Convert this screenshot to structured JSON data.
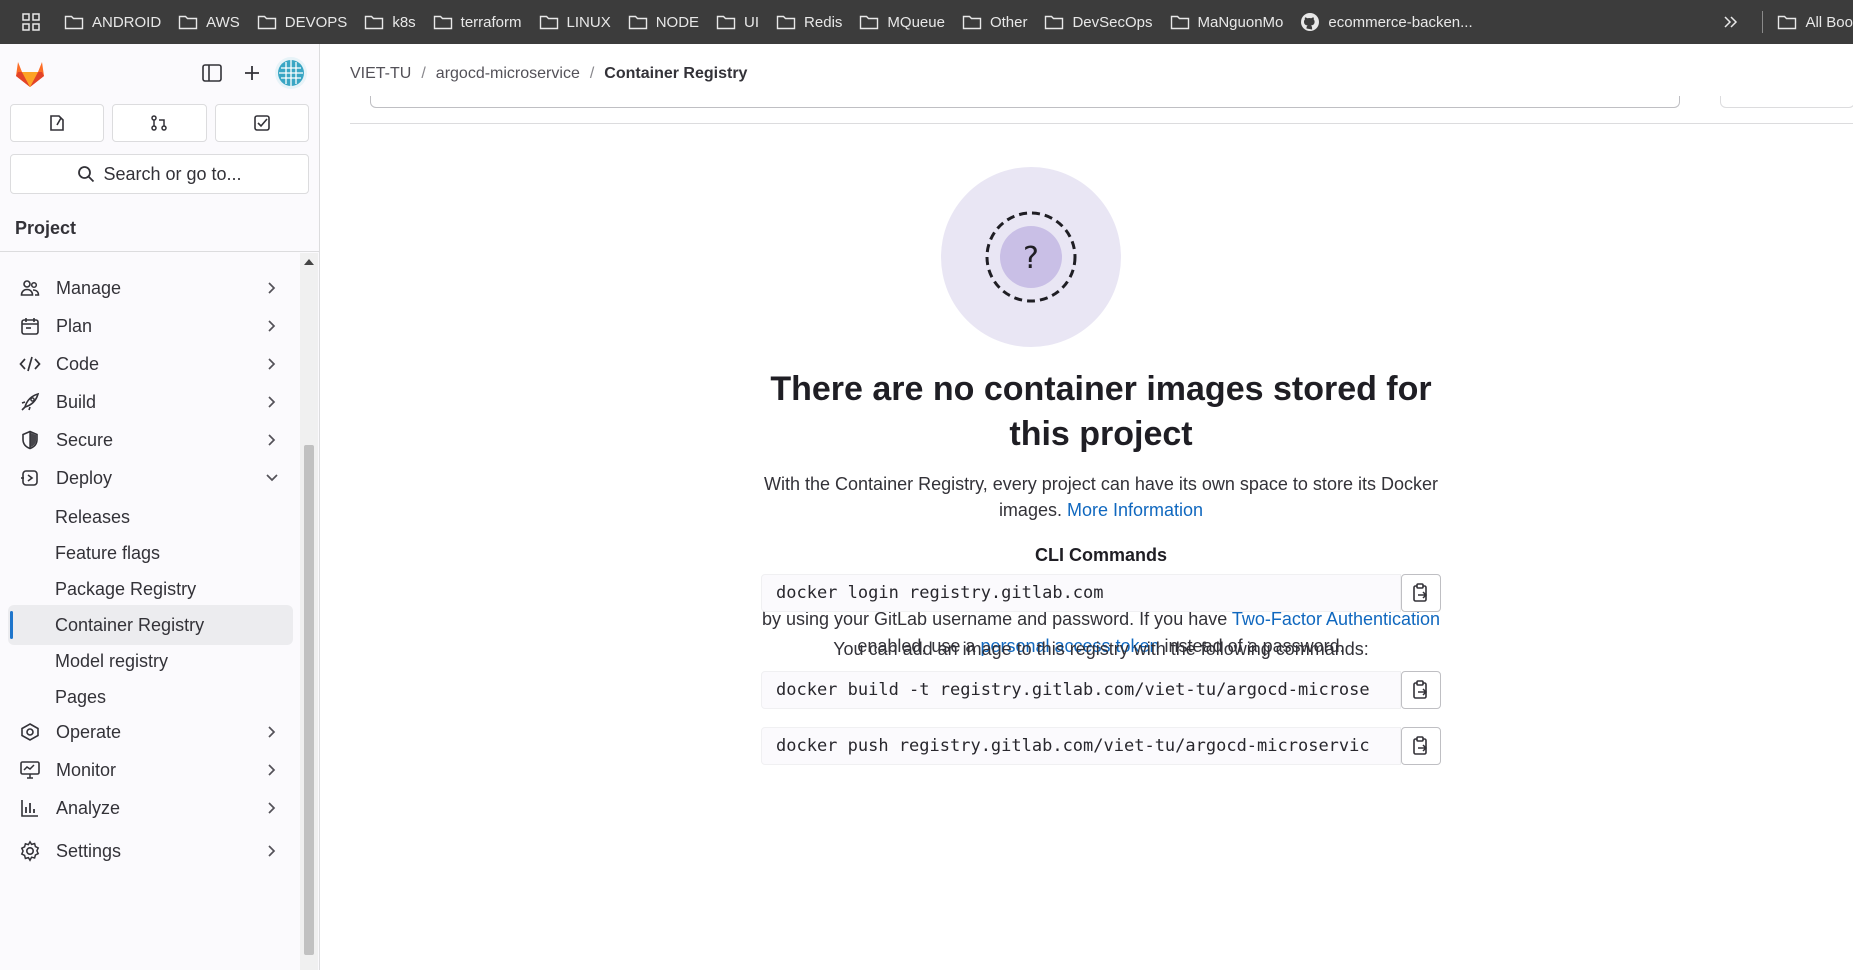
{
  "bookmarks": {
    "items": [
      {
        "label": "ANDROID",
        "icon": "folder-icon"
      },
      {
        "label": "AWS",
        "icon": "folder-icon"
      },
      {
        "label": "DEVOPS",
        "icon": "folder-icon"
      },
      {
        "label": "k8s",
        "icon": "folder-icon"
      },
      {
        "label": "terraform",
        "icon": "folder-icon"
      },
      {
        "label": "LINUX",
        "icon": "folder-icon"
      },
      {
        "label": "NODE",
        "icon": "folder-icon"
      },
      {
        "label": "UI",
        "icon": "folder-icon"
      },
      {
        "label": "Redis",
        "icon": "folder-icon"
      },
      {
        "label": "MQueue",
        "icon": "folder-icon"
      },
      {
        "label": "Other",
        "icon": "folder-icon"
      },
      {
        "label": "DevSecOps",
        "icon": "folder-icon"
      },
      {
        "label": "MaNguonMo",
        "icon": "folder-icon"
      },
      {
        "label": "ecommerce-backen...",
        "icon": "github-icon"
      }
    ],
    "all_bookmarks": "All Boo"
  },
  "sidebar": {
    "search_label": "Search or go to...",
    "section_title": "Project",
    "nav": [
      {
        "label": "Manage",
        "icon": "users-icon"
      },
      {
        "label": "Plan",
        "icon": "calendar-icon"
      },
      {
        "label": "Code",
        "icon": "code-icon"
      },
      {
        "label": "Build",
        "icon": "rocket-icon"
      },
      {
        "label": "Secure",
        "icon": "shield-icon"
      },
      {
        "label": "Deploy",
        "icon": "deploy-icon"
      }
    ],
    "deploy_sub": [
      "Releases",
      "Feature flags",
      "Package Registry",
      "Container Registry",
      "Model registry",
      "Pages"
    ],
    "nav_bottom": [
      {
        "label": "Operate",
        "icon": "operate-icon"
      },
      {
        "label": "Monitor",
        "icon": "monitor-icon"
      },
      {
        "label": "Analyze",
        "icon": "chart-icon"
      },
      {
        "label": "Settings",
        "icon": "gear-icon"
      }
    ]
  },
  "breadcrumb": {
    "items": [
      "VIET-TU",
      "argocd-microservice",
      "Container Registry"
    ]
  },
  "empty_state": {
    "title": "There are no container images stored for this project",
    "description": "With the Container Registry, every project can have its own space to store its Docker images.",
    "more_info_link": "More Information",
    "cli_title": "CLI Commands",
    "cli_desc_1": "If you are not already logged in, you need to authenticate to the Container Registry by using your GitLab username and password. If you have ",
    "cli_link_2fa": "Two-Factor Authentication",
    "cli_desc_2": " enabled, use a ",
    "cli_link_pat": "personal access token",
    "cli_desc_3": " instead of a password.",
    "login_cmd": "docker login registry.gitlab.com",
    "add_image_note": "You can add an image to this registry with the following commands:",
    "build_cmd": "docker build -t registry.gitlab.com/viet-tu/argocd-microse",
    "push_cmd": "docker push registry.gitlab.com/viet-tu/argocd-microservic"
  },
  "colors": {
    "link": "#1068bf",
    "illustration_bg": "#e9e6f4",
    "illustration_inner": "#c9bfe6"
  }
}
